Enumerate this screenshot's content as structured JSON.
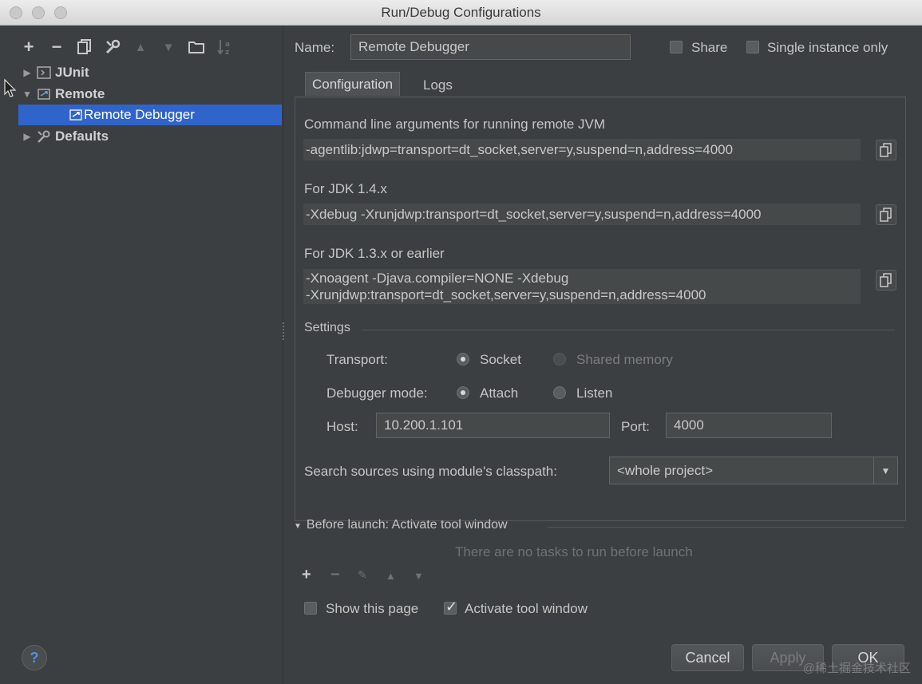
{
  "window": {
    "title": "Run/Debug Configurations"
  },
  "toolbar": {
    "icons": [
      "add-icon",
      "remove-icon",
      "copy-icon",
      "wrench-icon",
      "move-up-icon",
      "move-down-icon",
      "folder-icon",
      "sort-icon"
    ]
  },
  "tree": {
    "items": [
      {
        "label": "JUnit",
        "expanded": false
      },
      {
        "label": "Remote",
        "expanded": true
      },
      {
        "label": "Remote Debugger",
        "selected": true
      },
      {
        "label": "Defaults",
        "expanded": false
      }
    ]
  },
  "form": {
    "name_label": "Name:",
    "name_value": "Remote Debugger",
    "share_label": "Share",
    "single_instance_label": "Single instance only"
  },
  "tabs": [
    {
      "label": "Configuration",
      "active": true
    },
    {
      "label": "Logs",
      "active": false
    }
  ],
  "config": {
    "cmd_label": "Command line arguments for running remote JVM",
    "cmd_value": "-agentlib:jdwp=transport=dt_socket,server=y,suspend=n,address=4000",
    "jdk14_label": "For JDK 1.4.x",
    "jdk14_value": "-Xdebug -Xrunjdwp:transport=dt_socket,server=y,suspend=n,address=4000",
    "jdk13_label": "For JDK 1.3.x or earlier",
    "jdk13_line1": "-Xnoagent -Djava.compiler=NONE -Xdebug",
    "jdk13_line2": "-Xrunjdwp:transport=dt_socket,server=y,suspend=n,address=4000",
    "settings_label": "Settings",
    "transport_label": "Transport:",
    "transport_socket": "Socket",
    "transport_shared": "Shared memory",
    "mode_label": "Debugger mode:",
    "mode_attach": "Attach",
    "mode_listen": "Listen",
    "host_label": "Host:",
    "host_value": "10.200.1.101",
    "port_label": "Port:",
    "port_value": "4000",
    "classpath_label": "Search sources using module's classpath:",
    "classpath_value": "<whole project>"
  },
  "before_launch": {
    "header": "Before launch: Activate tool window",
    "empty_text": "There are no tasks to run before launch",
    "show_page_label": "Show this page",
    "activate_label": "Activate tool window"
  },
  "buttons": {
    "cancel": "Cancel",
    "apply": "Apply",
    "ok": "OK",
    "help": "?"
  },
  "watermark": "@稀土掘金技术社区"
}
